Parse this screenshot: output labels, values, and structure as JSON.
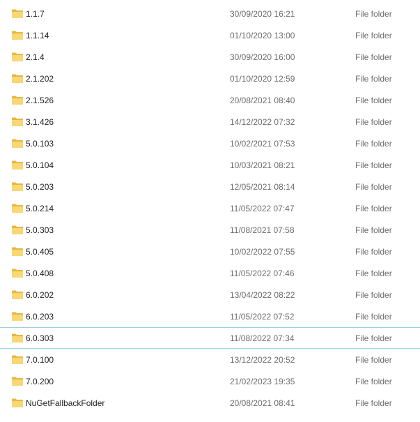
{
  "files": [
    {
      "name": "1.1.7",
      "date": "30/09/2020 16:21",
      "type": "File folder",
      "icon": "folder-icon"
    },
    {
      "name": "1.1.14",
      "date": "01/10/2020 13:00",
      "type": "File folder",
      "icon": "folder-icon"
    },
    {
      "name": "2.1.4",
      "date": "30/09/2020 16:00",
      "type": "File folder",
      "icon": "folder-icon"
    },
    {
      "name": "2.1.202",
      "date": "01/10/2020 12:59",
      "type": "File folder",
      "icon": "folder-icon"
    },
    {
      "name": "2.1.526",
      "date": "20/08/2021 08:40",
      "type": "File folder",
      "icon": "folder-icon"
    },
    {
      "name": "3.1.426",
      "date": "14/12/2022 07:32",
      "type": "File folder",
      "icon": "folder-icon"
    },
    {
      "name": "5.0.103",
      "date": "10/02/2021 07:53",
      "type": "File folder",
      "icon": "folder-icon"
    },
    {
      "name": "5.0.104",
      "date": "10/03/2021 08:21",
      "type": "File folder",
      "icon": "folder-icon"
    },
    {
      "name": "5.0.203",
      "date": "12/05/2021 08:14",
      "type": "File folder",
      "icon": "folder-icon"
    },
    {
      "name": "5.0.214",
      "date": "11/05/2022 07:47",
      "type": "File folder",
      "icon": "folder-icon"
    },
    {
      "name": "5.0.303",
      "date": "11/08/2021 07:58",
      "type": "File folder",
      "icon": "folder-icon"
    },
    {
      "name": "5.0.405",
      "date": "10/02/2022 07:55",
      "type": "File folder",
      "icon": "folder-icon"
    },
    {
      "name": "5.0.408",
      "date": "11/05/2022 07:46",
      "type": "File folder",
      "icon": "folder-icon"
    },
    {
      "name": "6.0.202",
      "date": "13/04/2022 08:22",
      "type": "File folder",
      "icon": "folder-icon"
    },
    {
      "name": "6.0.203",
      "date": "11/05/2022 07:52",
      "type": "File folder",
      "icon": "folder-icon"
    },
    {
      "name": "6.0.303",
      "date": "11/08/2022 07:34",
      "type": "File folder",
      "icon": "folder-icon",
      "focused": true
    },
    {
      "name": "7.0.100",
      "date": "13/12/2022 20:52",
      "type": "File folder",
      "icon": "folder-icon"
    },
    {
      "name": "7.0.200",
      "date": "21/02/2023 19:35",
      "type": "File folder",
      "icon": "folder-icon"
    },
    {
      "name": "NuGetFallbackFolder",
      "date": "20/08/2021 08:41",
      "type": "File folder",
      "icon": "folder-icon"
    }
  ],
  "colors": {
    "folder_front": "#f8d775",
    "folder_back": "#e8b73f",
    "focus_border": "#99d1e0",
    "secondary_text": "#6d6d6d"
  }
}
